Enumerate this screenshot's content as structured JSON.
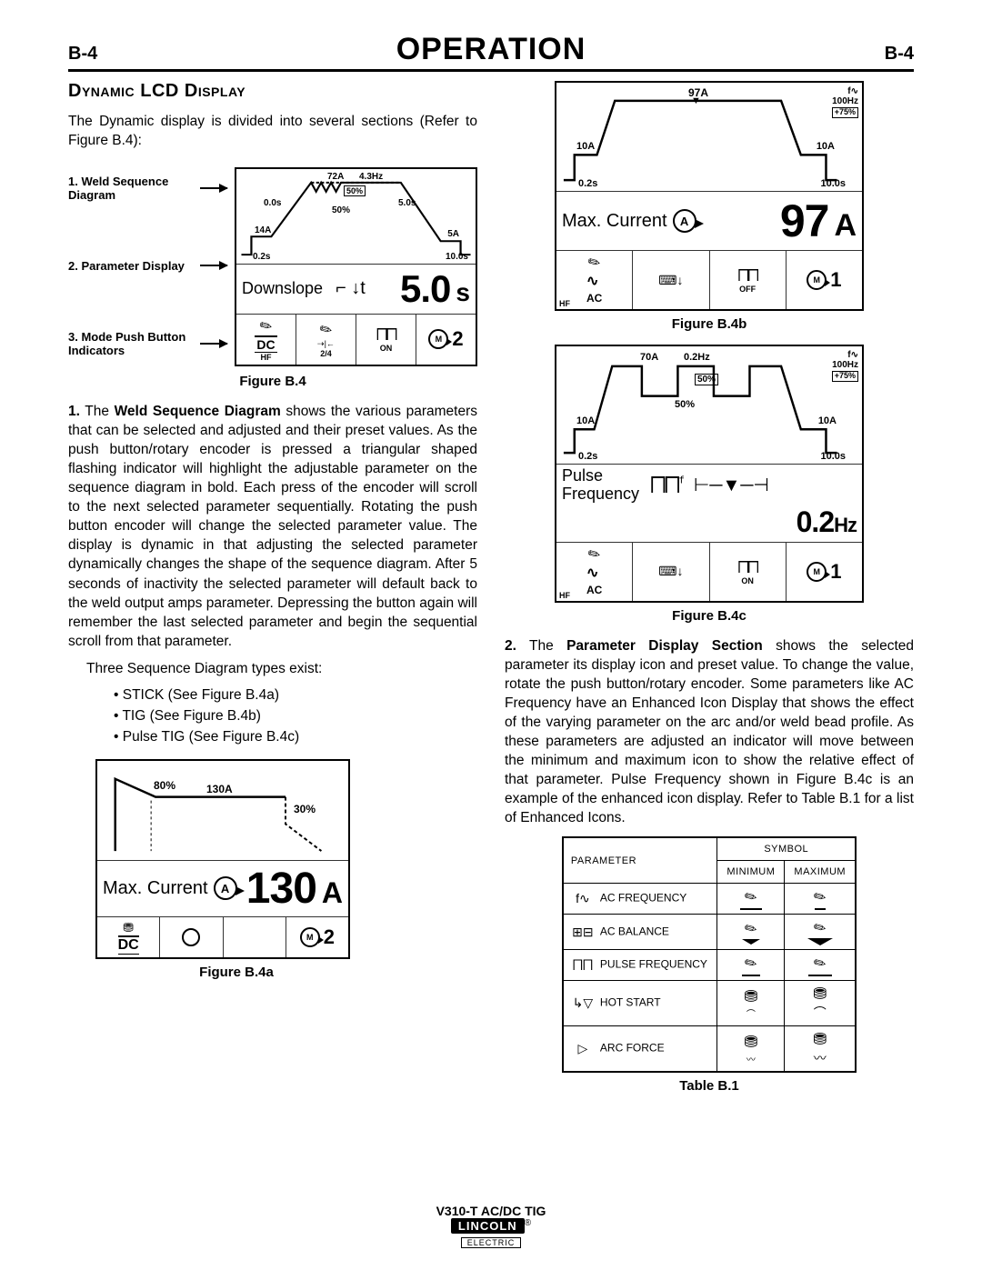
{
  "header": {
    "left": "B-4",
    "center": "OPERATION",
    "right": "B-4"
  },
  "leftCol": {
    "sectionTitle": "Dynamic LCD Display",
    "intro": "The Dynamic display is divided into several sections (Refer to Figure B.4):",
    "figB4_labels": {
      "l1": "1. Weld Sequence Diagram",
      "l2": "2. Parameter Display",
      "l3": "3. Mode Push Button Indicators"
    },
    "figB4_lcd": {
      "seq": {
        "peakA": "72A",
        "freq": "4.3Hz",
        "bal": "50%",
        "pulse": "50%",
        "up": "0.0s",
        "down": "5.0s",
        "startA": "14A",
        "endA": "5A",
        "pre": "0.2s",
        "post": "10.0s"
      },
      "pdisp": {
        "name": "Downslope",
        "icon": "↘t",
        "val": "5.0",
        "unit": "s"
      },
      "modes": {
        "hf": "HF",
        "dc": "DC",
        "trigger": "2/4",
        "pulse": "ON",
        "mem": "2"
      }
    },
    "figB4_caption": "Figure B.4",
    "item1_lead": "1.",
    "item1_bold": "Weld Sequence Diagram",
    "item1_body_a": " The ",
    "item1_body_b": " shows the various parameters that can be selected and adjusted and their preset values. As the push button/rotary encoder is pressed a triangular shaped flashing indicator will highlight the adjustable parameter on the sequence diagram in bold.  Each press of the encoder will scroll to the next selected parameter sequentially. Rotating the push button encoder will change the selected parameter value.  The display is dynamic in that adjusting the selected parameter dynamically changes the shape of the sequence diagram.  After 5 seconds of inactivity the selected parameter will default back to the weld output amps parameter.  Depressing the button again will remember the last selected parameter and begin the sequential scroll from that parameter.",
    "three_types": "Three Sequence Diagram types exist:",
    "types": {
      "a": "STICK (See Figure B.4a)",
      "b": "TIG  (See Figure B.4b)",
      "c": "Pulse TIG (See Figure B.4c)"
    },
    "stick": {
      "seq": {
        "hot": "80%",
        "amps": "130A",
        "arcf": "30%"
      },
      "pdisp": {
        "name": "Max. Current",
        "val": "130",
        "unit": "A"
      },
      "modes": {
        "dc": "DC",
        "mem": "2"
      }
    },
    "figB4a_caption": "Figure B.4a"
  },
  "rightCol": {
    "tig": {
      "seq": {
        "peakA": "97A",
        "startA": "10A",
        "endA": "10A",
        "pre": "0.2s",
        "post": "10.0s",
        "freq": "100Hz",
        "bal": "75%"
      },
      "pdisp": {
        "name": "Max. Current",
        "val": "97",
        "unit": "A"
      },
      "modes": {
        "hf": "HF",
        "ac": "AC",
        "pulse": "OFF",
        "mem": "1"
      }
    },
    "figB4b_caption": "Figure B.4b",
    "ptig": {
      "seq": {
        "peakA": "70A",
        "pfreq": "0.2Hz",
        "bal": "50%",
        "pulse": "50%",
        "startA": "10A",
        "endA": "10A",
        "pre": "0.2s",
        "post": "10.0s",
        "freq": "100Hz",
        "acbal": "75%"
      },
      "pdisp": {
        "name": "Pulse Frequency",
        "val": "0.2",
        "unit": "Hz"
      },
      "modes": {
        "hf": "HF",
        "ac": "AC",
        "pulse": "ON",
        "mem": "1"
      }
    },
    "figB4c_caption": "Figure B.4c",
    "item2_lead": "2.",
    "item2_bold": "Parameter Display Section",
    "item2_body_a": " The ",
    "item2_body_b": " shows the selected parameter its display icon and preset value. To change the value, rotate the push button/rotary encoder. Some parameters like AC Frequency have an Enhanced Icon Display that shows the effect of the varying parameter on the arc and/or weld bead profile.  As these parameters are adjusted an indicator will move between the minimum and maximum icon to show the relative effect of that parameter. Pulse Frequency shown in Figure B.4c is an example of the enhanced icon display.  Refer to Table B.1 for a list of Enhanced Icons.",
    "table": {
      "h_param": "PARAMETER",
      "h_sym": "SYMBOL",
      "h_min": "MINIMUM",
      "h_max": "MAXIMUM",
      "rows": [
        {
          "name": "AC FREQUENCY",
          "icon": "f∿"
        },
        {
          "name": "AC BALANCE",
          "icon": "⊞⊟"
        },
        {
          "name": "PULSE FREQUENCY",
          "icon": "⨅⨅"
        },
        {
          "name": "HOT START",
          "icon": "↳▽"
        },
        {
          "name": "ARC FORCE",
          "icon": "▷"
        }
      ]
    },
    "tableCaption": "Table B.1"
  },
  "footer": {
    "model": "V310-T AC/DC TIG",
    "brand": "LINCOLN",
    "elec": "ELECTRIC"
  }
}
